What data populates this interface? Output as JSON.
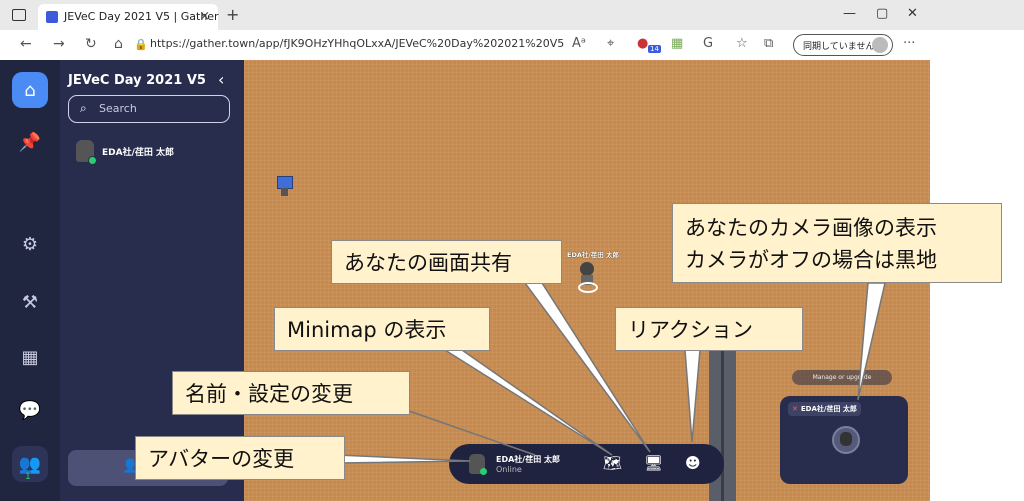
{
  "browser": {
    "tab_title": "JEVeC Day 2021 V5 | Gather",
    "tab_close": "×",
    "new_tab": "+",
    "url": "https://gather.town/app/fJK9OHzYHhqOLxxA/JEVeC%20Day%202021%20V5",
    "sync_label": "同期していません",
    "more": "···",
    "minimize": "—",
    "maximize": "▢",
    "close": "✕",
    "badge_count": "14"
  },
  "sidebar": {
    "space_title": "JEVeC Day 2021 V5",
    "search_placeholder": "Search",
    "participants": [
      {
        "name": "EDA社/荏田 太郎"
      }
    ],
    "online_count": "1"
  },
  "map": {
    "player_label": "EDA社/荏田 太郎",
    "upgrade_text": "Manage or upgrade"
  },
  "camera": {
    "label": "EDA社/荏田 太郎"
  },
  "bottom_bar": {
    "name": "EDA社/荏田 太郎",
    "status": "Online"
  },
  "callouts": {
    "avatar": "アバターの変更",
    "settings": "名前・設定の変更",
    "minimap": "Minimap の表示",
    "screen_share": "あなたの画面共有",
    "reaction": "リアクション",
    "camera": "あなたのカメラ画像の表示\nカメラがオフの場合は黒地"
  },
  "colors": {
    "map_floor": "#c68a4e",
    "sidebar": "#282d4e",
    "rail": "#202540",
    "accent": "#4a8bf5",
    "callout_fill": "#fff2cc",
    "online": "#2ecc71"
  }
}
